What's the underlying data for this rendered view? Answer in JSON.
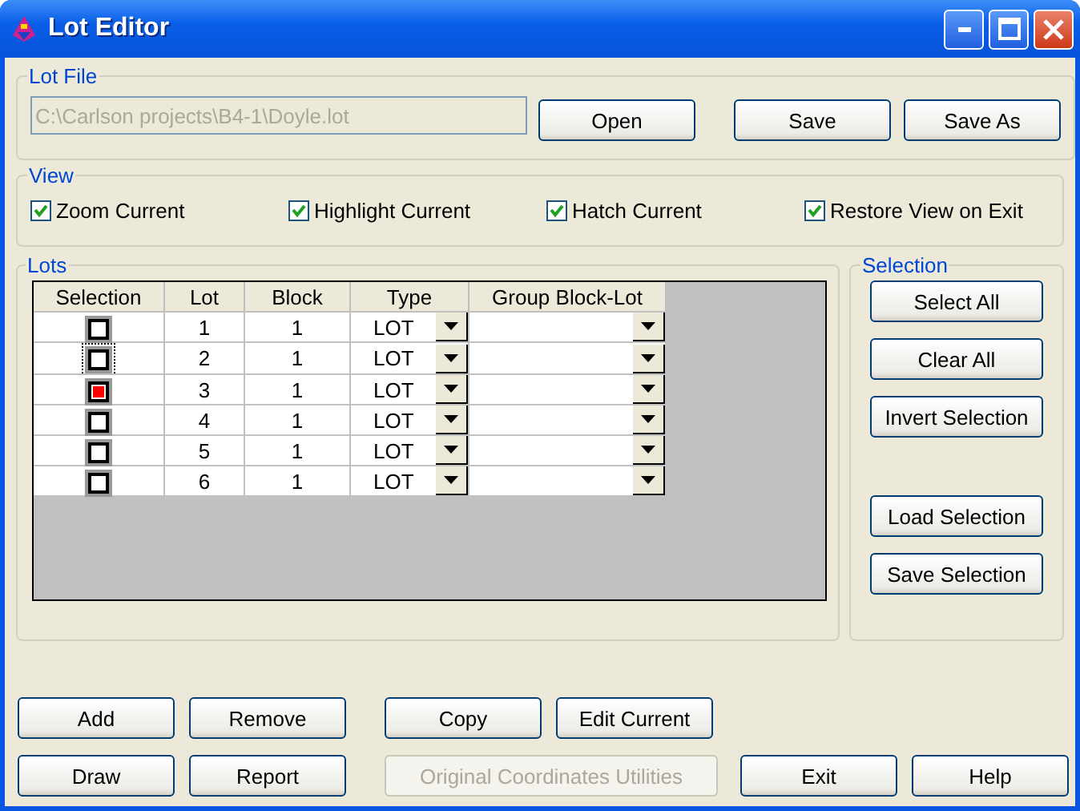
{
  "window": {
    "title": "Lot Editor"
  },
  "lot_file": {
    "title": "Lot File",
    "path": "C:\\Carlson projects\\B4-1\\Doyle.lot",
    "disabled": true,
    "buttons": [
      {
        "label": "Open"
      },
      {
        "label": "Save"
      },
      {
        "label": "Save As"
      }
    ]
  },
  "view": {
    "title": "View",
    "options": [
      {
        "label": "Zoom Current",
        "checked": true
      },
      {
        "label": "Highlight Current",
        "checked": true
      },
      {
        "label": "Hatch Current",
        "checked": true
      },
      {
        "label": "Restore View on Exit",
        "checked": true
      }
    ]
  },
  "lots": {
    "title": "Lots",
    "columns": [
      "Selection",
      "Lot",
      "Block",
      "Type",
      "Group Block-Lot"
    ],
    "rows": [
      {
        "checked": false,
        "focused": false,
        "lot": "1",
        "block": "1",
        "type": "LOT"
      },
      {
        "checked": false,
        "focused": true,
        "lot": "2",
        "block": "1",
        "type": "LOT"
      },
      {
        "checked": true,
        "focused": false,
        "lot": "3",
        "block": "1",
        "type": "LOT"
      },
      {
        "checked": false,
        "focused": false,
        "lot": "4",
        "block": "1",
        "type": "LOT"
      },
      {
        "checked": false,
        "focused": false,
        "lot": "5",
        "block": "1",
        "type": "LOT"
      },
      {
        "checked": false,
        "focused": false,
        "lot": "6",
        "block": "1",
        "type": "LOT"
      }
    ]
  },
  "selection": {
    "title": "Selection",
    "buttons": [
      {
        "label": "Select All"
      },
      {
        "label": "Clear All"
      },
      {
        "label": "Invert Selection"
      },
      {
        "label": "Load Selection"
      },
      {
        "label": "Save Selection"
      }
    ]
  },
  "bottom_buttons": [
    [
      {
        "label": "Add",
        "disabled": false
      },
      {
        "label": "Remove",
        "disabled": false
      },
      {
        "label": "Copy",
        "disabled": false
      },
      {
        "label": "Edit Current",
        "disabled": false
      }
    ],
    [
      {
        "label": "Draw",
        "disabled": false
      },
      {
        "label": "Report",
        "disabled": false
      },
      {
        "label": "Original Coordinates Utilities",
        "disabled": true
      },
      {
        "label": "Exit",
        "disabled": false
      },
      {
        "label": "Help",
        "disabled": false
      }
    ]
  ]
}
